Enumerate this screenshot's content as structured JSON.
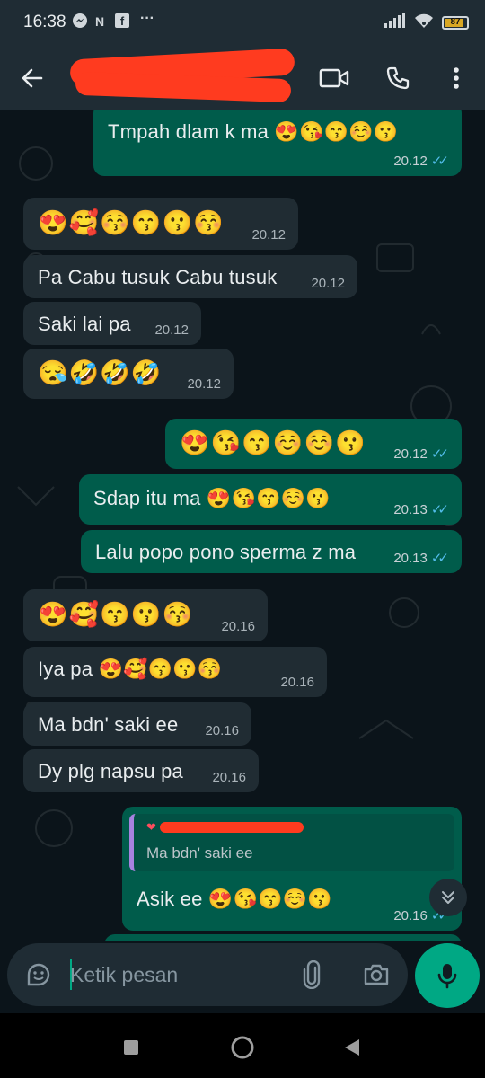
{
  "status_bar": {
    "time": "16:38",
    "notif_n": "N",
    "notif_f": "f",
    "more": "···",
    "battery": "87",
    "battery_level": 0.87
  },
  "header": {
    "contact_name_redacted": "",
    "icons": [
      "back-arrow-icon",
      "video-call-icon",
      "phone-icon",
      "more-vert-icon"
    ]
  },
  "messages": [
    {
      "dir": "out",
      "text": "Tmpah dlam k ma 😍😘😙☺️😗",
      "time": "20.12",
      "read": true
    },
    {
      "dir": "in",
      "text": "😍🥰😚😙😗😚",
      "time": "20.12"
    },
    {
      "dir": "in",
      "text": "Pa Cabu tusuk Cabu tusuk",
      "time": "20.12"
    },
    {
      "dir": "in",
      "text": "Saki lai pa",
      "time": "20.12"
    },
    {
      "dir": "in",
      "text": "😪🤣🤣🤣",
      "time": "20.12"
    },
    {
      "dir": "out",
      "text": "😍😘😙☺️☺️😗",
      "time": "20.12",
      "read": true
    },
    {
      "dir": "out",
      "text": "Sdap itu ma 😍😘😙☺️😗",
      "time": "20.13",
      "read": true
    },
    {
      "dir": "out",
      "text": "Lalu popo pono sperma z ma",
      "time": "20.13",
      "read": true
    },
    {
      "dir": "in",
      "text": "😍🥰😙😗😚",
      "time": "20.16"
    },
    {
      "dir": "in",
      "text": "Iya pa 😍🥰😙😗😚",
      "time": "20.16"
    },
    {
      "dir": "in",
      "text": "Ma bdn' saki ee",
      "time": "20.16"
    },
    {
      "dir": "in",
      "text": "Dy plg napsu pa",
      "time": "20.16"
    },
    {
      "dir": "out",
      "text": "Asik ee 😍😘😙☺️😗",
      "time": "20.16",
      "read": true,
      "quote": {
        "author_redacted": "",
        "text": "Ma bdn' saki ee"
      }
    }
  ],
  "composer": {
    "placeholder": "Ketik pesan"
  },
  "colors": {
    "header": "#1f2c34",
    "chat_bg": "#0b141a",
    "incoming": "#202c33",
    "outgoing": "#005c4b",
    "accent": "#00a884",
    "read_ticks": "#53bdeb",
    "redaction": "#ff3b1f"
  }
}
